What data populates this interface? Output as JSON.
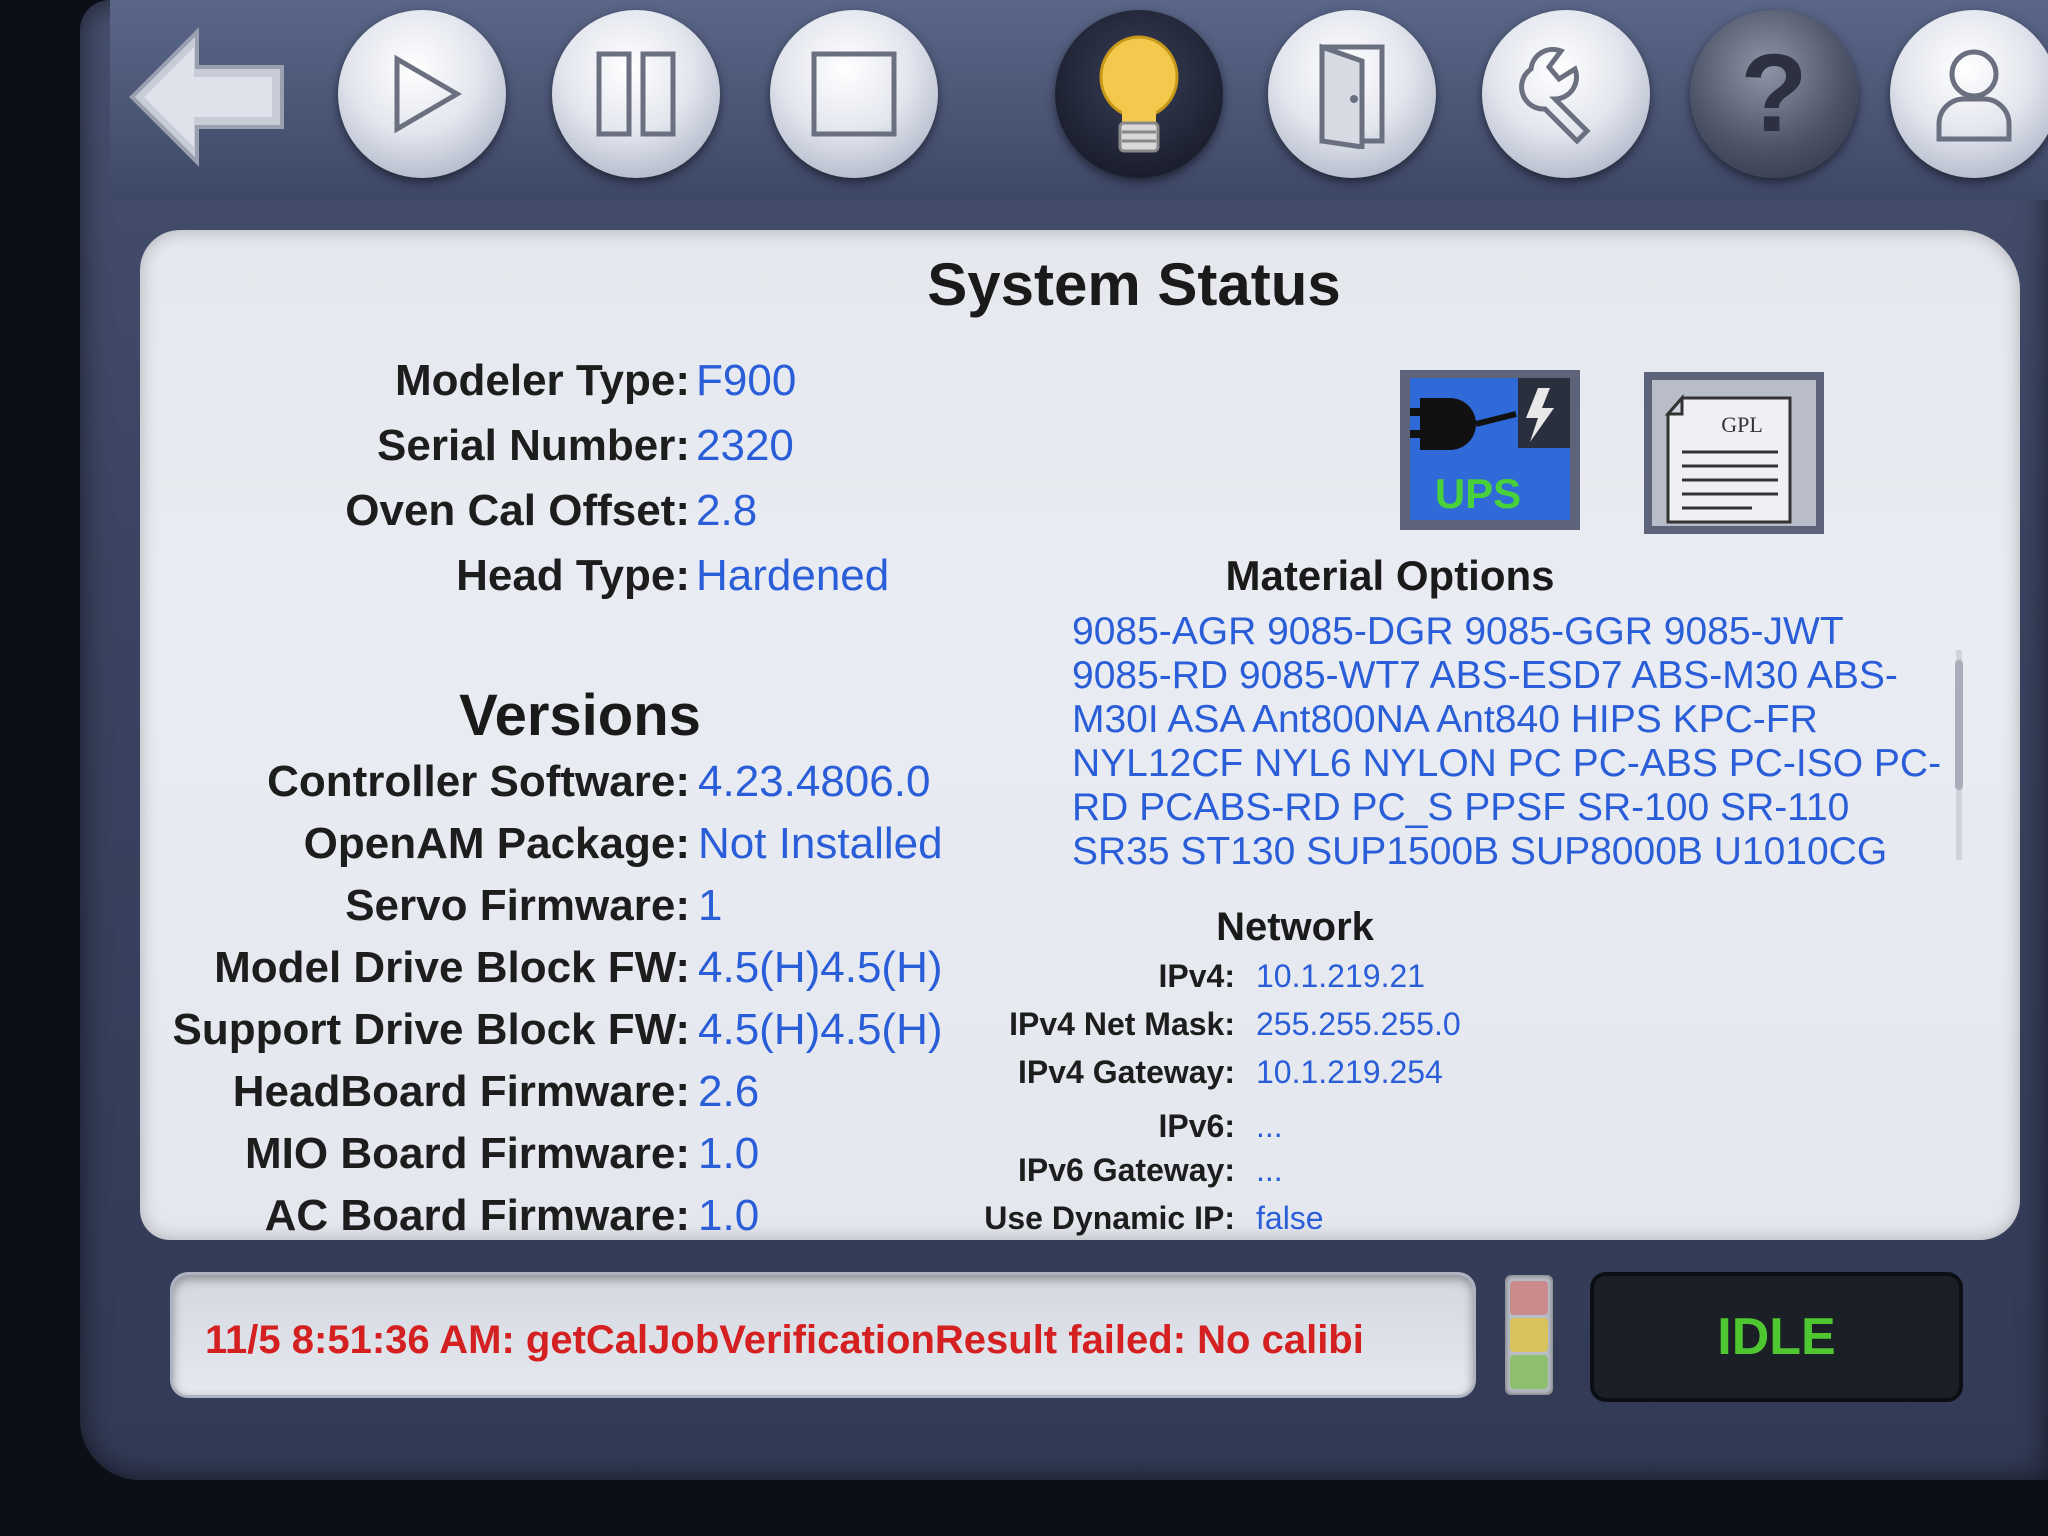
{
  "toolbar": {
    "buttons": [
      {
        "name": "back",
        "icon": "back-arrow-icon"
      },
      {
        "name": "play",
        "icon": "play-icon"
      },
      {
        "name": "pause",
        "icon": "pause-icon"
      },
      {
        "name": "stop",
        "icon": "stop-icon"
      },
      {
        "name": "status",
        "icon": "lightbulb-icon",
        "active": true
      },
      {
        "name": "material",
        "icon": "door-icon"
      },
      {
        "name": "maintenance",
        "icon": "wrench-icon"
      },
      {
        "name": "help",
        "icon": "help-icon"
      },
      {
        "name": "user",
        "icon": "user-icon"
      }
    ]
  },
  "page": {
    "title": "System Status"
  },
  "system": {
    "modeler_type_label": "Modeler Type:",
    "modeler_type": "F900",
    "serial_label": "Serial Number:",
    "serial": "2320",
    "oven_label": "Oven Cal Offset:",
    "oven": "2.8",
    "head_label": "Head Type:",
    "head": "Hardened"
  },
  "icons": {
    "ups_label": "UPS",
    "gpl_label": "GPL"
  },
  "versions": {
    "heading": "Versions",
    "items": [
      {
        "label": "Controller Software:",
        "value": "4.23.4806.0"
      },
      {
        "label": "OpenAM Package:",
        "value": "Not Installed"
      },
      {
        "label": "Servo Firmware:",
        "value": "1"
      },
      {
        "label": "Model Drive Block FW:",
        "value": "4.5(H)4.5(H)"
      },
      {
        "label": "Support Drive Block FW:",
        "value": "4.5(H)4.5(H)"
      },
      {
        "label": "HeadBoard Firmware:",
        "value": "2.6"
      },
      {
        "label": "MIO Board Firmware:",
        "value": "1.0"
      },
      {
        "label": "AC Board Firmware:",
        "value": "1.0"
      }
    ]
  },
  "materials": {
    "heading": "Material Options",
    "lines": [
      "9085-AGR 9085-DGR 9085-GGR 9085-JWT",
      "9085-RD 9085-WT7 ABS-ESD7 ABS-M30 ABS-",
      "M30I ASA Ant800NA Ant840 HIPS KPC-FR",
      "NYL12CF NYL6 NYLON PC PC-ABS PC-ISO PC-",
      "RD PCABS-RD PC_S PPSF SR-100 SR-110",
      "SR35 ST130 SUP1500B SUP8000B U1010CG"
    ]
  },
  "network": {
    "heading": "Network",
    "items": [
      {
        "label": "IPv4:",
        "value": "10.1.219.21"
      },
      {
        "label": "IPv4 Net Mask:",
        "value": "255.255.255.0"
      },
      {
        "label": "IPv4 Gateway:",
        "value": "10.1.219.254"
      },
      {
        "label": "IPv6:",
        "value": "..."
      },
      {
        "label": "IPv6 Gateway:",
        "value": "..."
      },
      {
        "label": "Use Dynamic IP:",
        "value": "false"
      }
    ]
  },
  "status": {
    "message": "11/5 8:51:36 AM: getCalJobVerificationResult failed: No calibi",
    "state": "IDLE"
  },
  "colors": {
    "value_blue": "#2a5ed8",
    "error_red": "#d42020",
    "idle_green": "#4fc730"
  }
}
